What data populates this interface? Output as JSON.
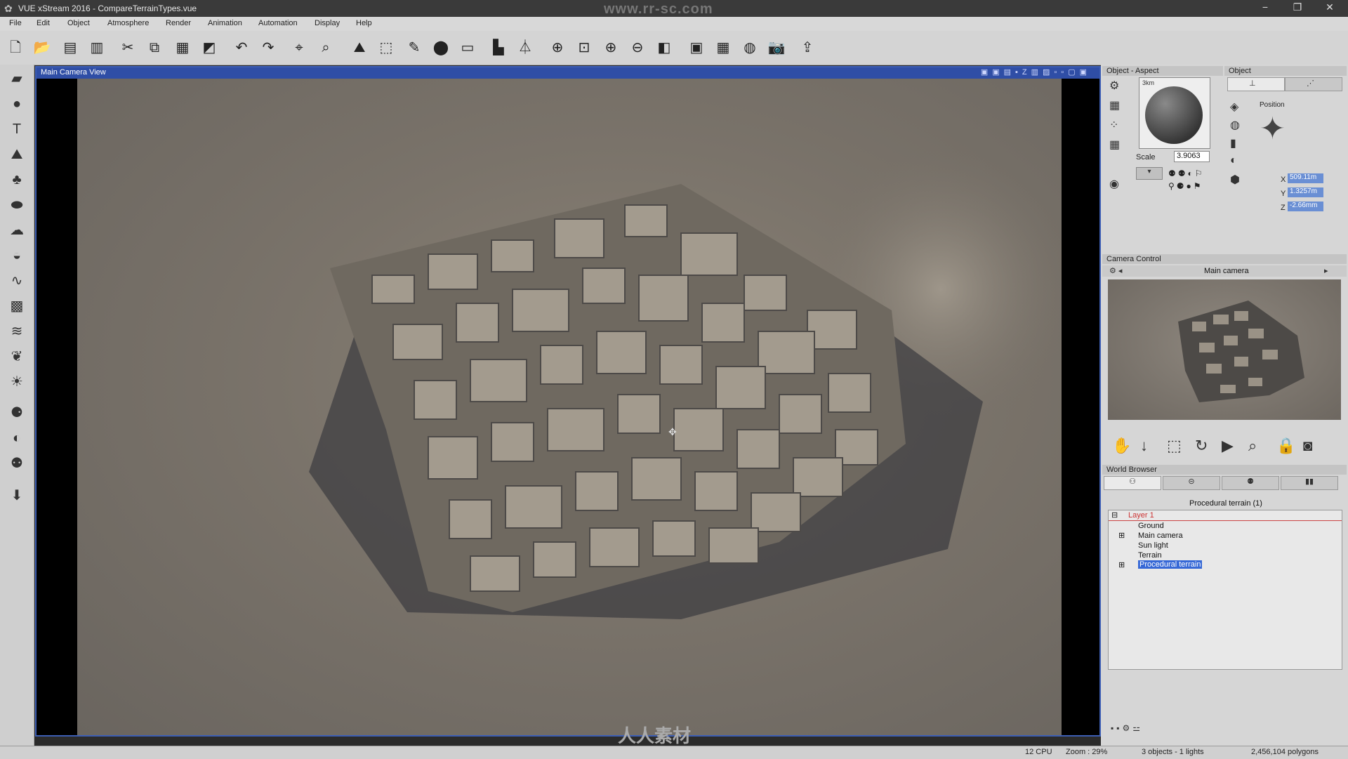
{
  "window": {
    "title": "VUE xStream 2016 - CompareTerrainTypes.vue",
    "watermark_top": "www.rr-sc.com",
    "watermark_bottom": "人人素材"
  },
  "menu": [
    "File",
    "Edit",
    "Object",
    "Atmosphere",
    "Render",
    "Animation",
    "Automation",
    "Display",
    "Help"
  ],
  "viewport": {
    "title": "Main Camera View"
  },
  "aspect_panel": {
    "title": "Object - Aspect",
    "scale_label": "Scale",
    "scale_value": "3.9063",
    "material_tag": "3km"
  },
  "object_panel": {
    "title": "Object",
    "position_label": "Position",
    "x_label": "X",
    "x_value": "509.11m",
    "y_label": "Y",
    "y_value": "1.3257m",
    "z_label": "Z",
    "z_value": "-2.66mm"
  },
  "camera_panel": {
    "title": "Camera Control",
    "camera_name": "Main camera"
  },
  "world_browser": {
    "title": "World Browser",
    "subtitle": "Procedural terrain (1)",
    "items": [
      "Layer 1",
      "Ground",
      "Main camera",
      "Sun light",
      "Terrain",
      "Procedural terrain"
    ]
  },
  "status": {
    "cpu": "12 CPU",
    "zoom": "Zoom : 29%",
    "objects": "3 objects - 1 lights",
    "polygons": "2,456,104 polygons"
  },
  "icons": {
    "window_min": "−",
    "window_max": "❐",
    "window_close": "✕"
  }
}
